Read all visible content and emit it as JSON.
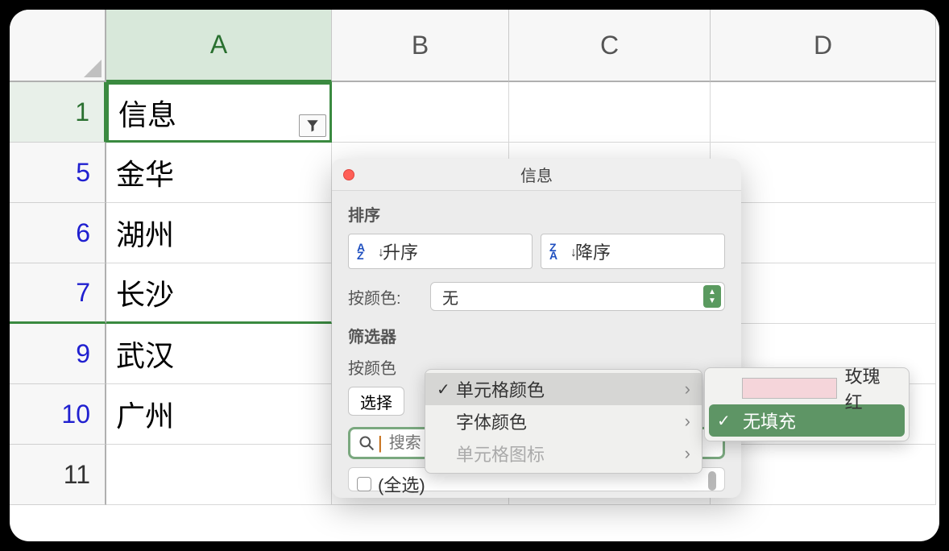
{
  "columns": [
    "A",
    "B",
    "C",
    "D"
  ],
  "rows": [
    {
      "num": "1",
      "color": "green",
      "value": "信息",
      "active": true
    },
    {
      "num": "5",
      "color": "blue",
      "value": "金华"
    },
    {
      "num": "6",
      "color": "blue",
      "value": "湖州"
    },
    {
      "num": "7",
      "color": "blue",
      "value": "长沙"
    },
    {
      "num": "9",
      "color": "blue",
      "value": "武汉"
    },
    {
      "num": "10",
      "color": "blue",
      "value": "广州"
    },
    {
      "num": "11",
      "color": "black",
      "value": ""
    }
  ],
  "dialog": {
    "title": "信息",
    "sort_label": "排序",
    "asc_label": "升序",
    "desc_label": "降序",
    "by_color_label": "按颜色:",
    "by_color_value": "无",
    "filter_section": "筛选器",
    "filter_by_color_label": "按颜色",
    "choose_label": "选择",
    "search_placeholder": "搜索",
    "list_first": "(全选)"
  },
  "submenu1": {
    "items": [
      {
        "label": "单元格颜色",
        "checked": true,
        "chevron": true,
        "highlight": true
      },
      {
        "label": "字体颜色",
        "checked": false,
        "chevron": true
      },
      {
        "label": "单元格图标",
        "checked": false,
        "chevron": true,
        "disabled": true
      }
    ]
  },
  "submenu2": {
    "rose_label": "玫瑰红",
    "no_fill_label": "无填充",
    "swatch_color": "#f5d5da"
  }
}
